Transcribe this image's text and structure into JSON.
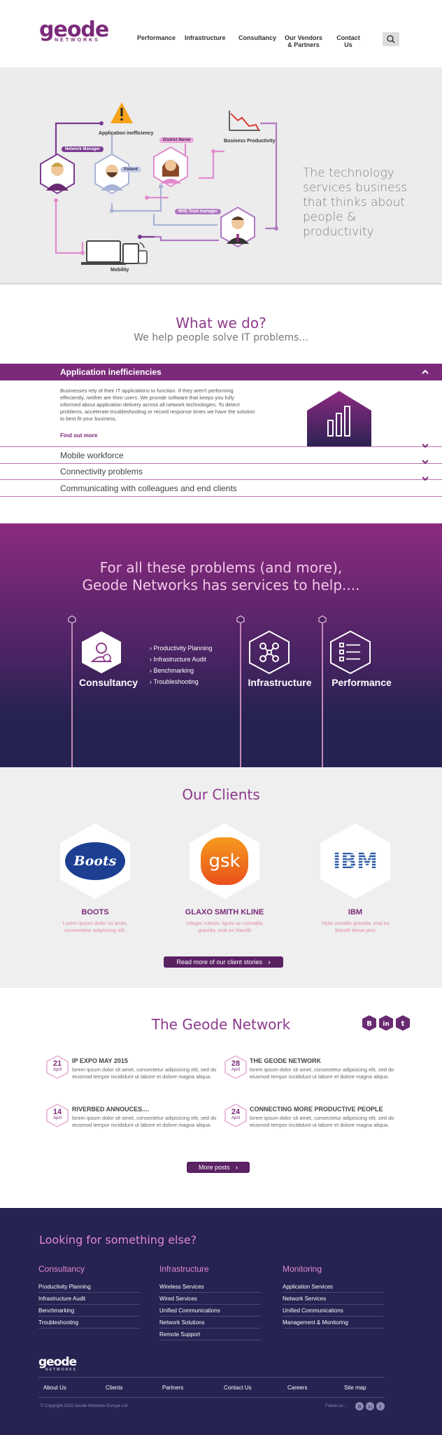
{
  "header": {
    "logo_text": "geode",
    "logo_sub": "NETWORKS",
    "nav": [
      {
        "label": "Performance"
      },
      {
        "label": "Infrastructure"
      },
      {
        "label": "Consultancy"
      },
      {
        "label": "Our Vendors & Partners"
      },
      {
        "label": "Contact Us"
      }
    ],
    "search_icon": "search-icon"
  },
  "hero": {
    "tagline": "The technology services business that thinks about people & productivity",
    "labels": {
      "app_ineff": "Application inefficiency",
      "network_manager": "Network Manager",
      "district_nurse": "District Nurse",
      "patient": "Patient",
      "business_productivity": "Business Productivity",
      "nhs_trust_manager": "NHS Trust manager",
      "mobility": "Mobility"
    }
  },
  "what": {
    "title": "What we do?",
    "subtitle": "We help people solve IT problems...",
    "accordion": [
      {
        "label": "Application inefficiencies",
        "open": true
      },
      {
        "label": "Mobile workforce",
        "open": false
      },
      {
        "label": "Connectivity problems",
        "open": false
      },
      {
        "label": "Communicating with colleagues and end clients",
        "open": false
      }
    ],
    "body": "Businesses rely of their IT applications to function. If they aren't performing effeciently, neither are their users. We provide software that keeps you fully informed about application delivery across all network technologies. To detect problems, accelerate troubleshooting or record response times we have the solution to best fit your business.",
    "find_out": "Find out more"
  },
  "services": {
    "heading": "For all these problems (and more), Geode Networks has services to help....",
    "items": [
      {
        "name": "Consultancy",
        "icon": "consultancy-icon"
      },
      {
        "name": "Infrastructure",
        "icon": "network-icon"
      },
      {
        "name": "Performance",
        "icon": "checklist-icon"
      }
    ],
    "consultancy_list": [
      "Productivity Planning",
      "Infrastructure Audit",
      "Benchmarking",
      "Troubleshooting"
    ]
  },
  "clients": {
    "title": "Our Clients",
    "items": [
      {
        "name": "BOOTS",
        "desc": "Lorem ipsum dolor sit amet, consectetur adipiscing elit.",
        "logo": "Boots"
      },
      {
        "name": "GLAXO SMITH KLINE",
        "desc": "Integer rutrum, ligula ac convallis gravida, erat ex blandit",
        "logo": "gsk"
      },
      {
        "name": "IBM",
        "desc": "Vipla onvallis gravida, erat ex blandit kimai jaso",
        "logo": "IBM"
      }
    ],
    "more_button": "Read more of our client stories"
  },
  "network": {
    "title": "The Geode Network",
    "social": [
      "blogger-icon",
      "linkedin-icon",
      "twitter-icon"
    ],
    "posts": [
      {
        "day": "21",
        "month": "April",
        "title": "IP EXPO MAY 2015",
        "text": "lorem ipsum dolor sit amet, consectetur adipisicing elit, sed do eiusmod tempor incididunt ut labore et dolore magna aliqua."
      },
      {
        "day": "28",
        "month": "April",
        "title": "THE GEODE NETWORK",
        "text": "lorem ipsum dolor sit amet, consectetur adipisicing elit, sed do eiusmod tempor incididunt ut labore et dolore magna aliqua."
      },
      {
        "day": "14",
        "month": "April",
        "title": "RIVERBED ANNOUCES....",
        "text": "lorem ipsum dolor sit amet, consectetur adipisicing elit, sed do eiusmod tempor incididunt ut labore et dolore magna aliqua."
      },
      {
        "day": "24",
        "month": "April",
        "title": "CONNECTING MORE PRODUCTIVE PEOPLE",
        "text": "lorem ipsum dolor sit amet, consectetur adipisicing elit, sed do eiusmod tempor incididunt ut labore et dolore magna aliqua."
      }
    ],
    "more_posts": "More posts"
  },
  "footer": {
    "title": "Looking for something else?",
    "columns": [
      {
        "title": "Consultancy",
        "links": [
          "Productivity Planning",
          "Infrastructure Audit",
          "Benchmarking",
          "Troubleshooting"
        ]
      },
      {
        "title": "Infrastructure",
        "links": [
          "Wireless Services",
          "Wired Services",
          "Unified Communications",
          "Network Solutions",
          "Remote Support"
        ]
      },
      {
        "title": "Monitoring",
        "links": [
          "Application Services",
          "Network Services",
          "Unified Communications",
          "Management & Monitoring"
        ]
      }
    ],
    "logo_text": "geode",
    "logo_sub": "NETWORKS",
    "bottom_nav": [
      "About Us",
      "Clients",
      "Partners",
      "Contact Us",
      "Careers",
      "Site map"
    ],
    "copyright": "© Copyright 2015 Geode Networks Europe Ltd",
    "follow": "Follow us..."
  },
  "colors": {
    "brand": "#7b2a7a",
    "footer_bg": "#262251",
    "pink": "#e18ad0"
  }
}
